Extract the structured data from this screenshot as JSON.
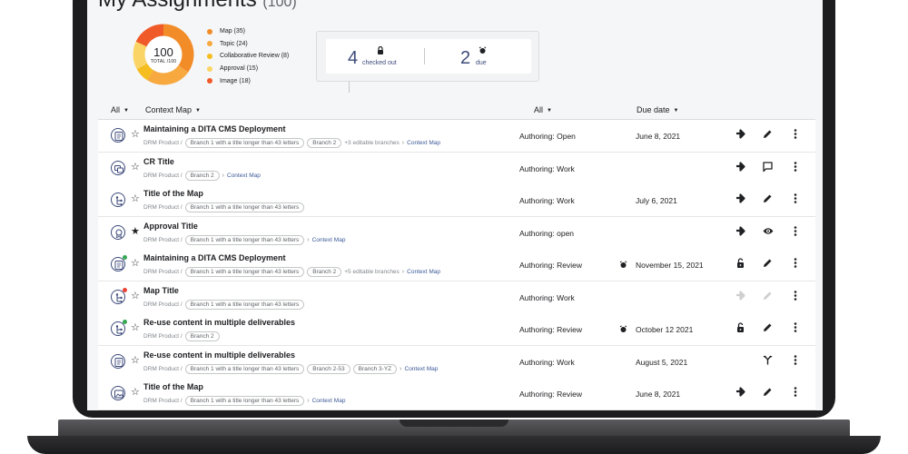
{
  "header": {
    "title": "My Assignments",
    "count": "(100)"
  },
  "summary": {
    "total_value": "100",
    "total_label": "TOTAL /100",
    "legend": [
      {
        "label": "Map (35)",
        "value": 35,
        "color": "#f28c28"
      },
      {
        "label": "Topic (24)",
        "value": 24,
        "color": "#f7a940"
      },
      {
        "label": "Collaborative Review (8)",
        "value": 8,
        "color": "#f5bd1f"
      },
      {
        "label": "Approval (15)",
        "value": 15,
        "color": "#fad566"
      },
      {
        "label": "Image (18)",
        "value": 18,
        "color": "#f05a28"
      }
    ]
  },
  "stats": {
    "checked_out_value": "4",
    "checked_out_label": "checked out",
    "checked_out_icon": "lock-icon",
    "due_value": "2",
    "due_label": "due",
    "due_icon": "alarm-icon"
  },
  "filters": {
    "type": "All",
    "scope": "Context Map",
    "status": "All",
    "sort": "Due date"
  },
  "rows": [
    {
      "title": "Maintaining a DITA CMS Deployment",
      "icon": "topic-document-icon",
      "starred": false,
      "badge": "",
      "product": "DRM Product /",
      "branches": [
        "Branch 1 with a title longer than 43 letters",
        "Branch 2"
      ],
      "more": "+3 editable branches",
      "context": "Context Map",
      "status": "Authoring: Open",
      "alarm": false,
      "due": "June 8, 2021",
      "actions": [
        "arrow-right-icon",
        "edit-pencil-icon",
        "more-vertical-icon"
      ]
    },
    {
      "title": "CR Title",
      "icon": "collaborative-review-icon",
      "starred": false,
      "badge": "",
      "product": "DRM Product /",
      "branches": [
        "Branch 2"
      ],
      "more": "",
      "context": "Context Map",
      "status": "Authoring: Work",
      "alarm": false,
      "due": "",
      "actions": [
        "arrow-right-icon",
        "comment-icon",
        "more-vertical-icon"
      ]
    },
    {
      "title": "Title of the Map",
      "icon": "map-tree-icon",
      "starred": false,
      "badge": "",
      "product": "DRM Product /",
      "branches": [
        "Branch 1 with a title longer than 43 letters"
      ],
      "more": "",
      "context": "",
      "status": "Authoring: Work",
      "alarm": false,
      "due": "July 6, 2021",
      "actions": [
        "arrow-right-icon",
        "edit-pencil-icon",
        "more-vertical-icon"
      ]
    },
    {
      "title": "Approval Title",
      "icon": "approval-badge-icon",
      "starred": true,
      "badge": "",
      "product": "DRM Product /",
      "branches": [
        "Branch 1 with a title longer than 43 letters"
      ],
      "more": "",
      "context": "Context Map",
      "status": "Authoring: open",
      "alarm": false,
      "due": "",
      "actions": [
        "arrow-right-icon",
        "view-eye-icon",
        "more-vertical-icon"
      ]
    },
    {
      "title": "Maintaining a DITA CMS Deployment",
      "icon": "topic-document-icon",
      "starred": false,
      "badge": "#34a853",
      "product": "DRM Product /",
      "branches": [
        "Branch 1 with a title longer than 43 letters",
        "Branch 2"
      ],
      "more": "+5 editable branches",
      "context": "Context Map",
      "status": "Authoring: Review",
      "alarm": true,
      "due": "November 15, 2021",
      "actions": [
        "unlocked-icon",
        "edit-pencil-icon",
        "more-vertical-icon"
      ]
    },
    {
      "title": "Map Title",
      "icon": "map-tree-icon",
      "starred": false,
      "badge": "#ea4335",
      "product": "DRM Product /",
      "branches": [
        "Branch 1 with a title longer than 43 letters"
      ],
      "more": "",
      "context": "",
      "status": "Authoring: Work",
      "alarm": false,
      "due": "",
      "disabled_actions": true,
      "actions": [
        "arrow-right-icon",
        "edit-pencil-icon",
        "more-vertical-icon"
      ]
    },
    {
      "title": "Re-use content in multiple deliverables",
      "icon": "map-tree-icon",
      "starred": false,
      "badge": "#34a853",
      "product": "DRM Product /",
      "branches": [
        "Branch 2"
      ],
      "more": "",
      "context": "",
      "status": "Authoring: Review",
      "alarm": true,
      "due": "October 12 2021",
      "actions": [
        "unlocked-icon",
        "edit-pencil-icon",
        "more-vertical-icon"
      ]
    },
    {
      "title": "Re-use content in multiple deliverables",
      "icon": "topic-document-icon",
      "starred": false,
      "badge": "",
      "product": "DRM Product /",
      "branches": [
        "Branch 1 with a title longer than 43 letters",
        "Branch 2-53",
        "Branch 3-YZ"
      ],
      "more": "",
      "context": "Context Map",
      "status": "Authoring: Work",
      "alarm": false,
      "due": "August 5, 2021",
      "actions": [
        "",
        "merge-branch-icon",
        "more-vertical-icon"
      ]
    },
    {
      "title": "Title of the Map",
      "icon": "image-icon",
      "starred": false,
      "badge": "",
      "product": "DRM Product /",
      "branches": [
        "Branch 1 with a title longer than 43 letters"
      ],
      "more": "",
      "context": "Context Map",
      "status": "Authoring: Review",
      "alarm": false,
      "due": "June 8, 2021",
      "actions": [
        "arrow-right-icon",
        "edit-pencil-icon",
        "more-vertical-icon"
      ]
    }
  ]
}
